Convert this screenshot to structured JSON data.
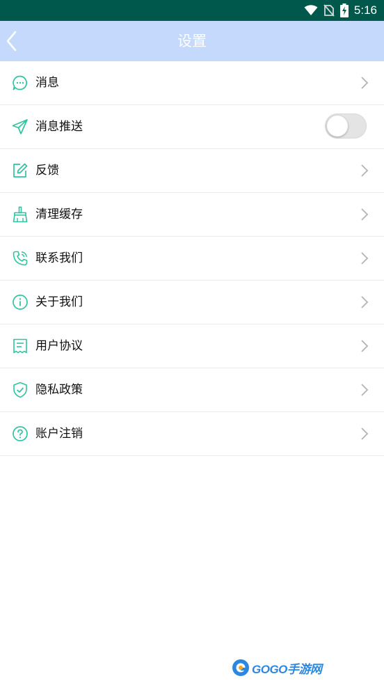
{
  "status_bar": {
    "time": "5:16",
    "icons": [
      "wifi-icon",
      "no-sim-icon",
      "battery-charging-icon"
    ],
    "color": "#00574b"
  },
  "app_bar": {
    "title": "设置",
    "background": "#c4d9fb",
    "back_icon": "chevron-left-icon"
  },
  "menu": {
    "accent_color": "#2ec4a0",
    "items": [
      {
        "label": "消息",
        "icon": "chat-bubble-icon"
      },
      {
        "label": "消息推送",
        "icon": "paper-plane-icon",
        "toggle_on": false
      },
      {
        "label": "反馈",
        "icon": "edit-icon"
      },
      {
        "label": "清理缓存",
        "icon": "broom-icon"
      },
      {
        "label": "联系我们",
        "icon": "phone-icon"
      },
      {
        "label": "关于我们",
        "icon": "info-icon"
      },
      {
        "label": "用户协议",
        "icon": "document-icon"
      },
      {
        "label": "隐私政策",
        "icon": "shield-check-icon"
      },
      {
        "label": "账户注销",
        "icon": "question-circle-icon"
      }
    ]
  },
  "watermark": {
    "text": "GOGO手游网",
    "logo": "gogo-logo"
  }
}
